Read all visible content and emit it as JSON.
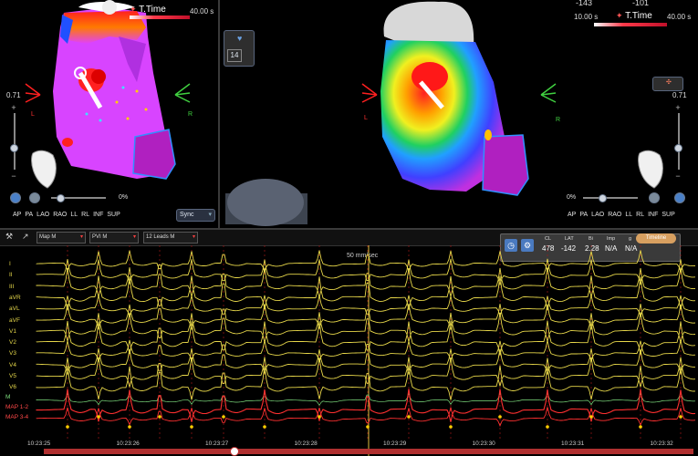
{
  "left_view": {
    "time_label": "T.Time",
    "seconds": "40.00 s",
    "scale_max": "0.71",
    "zoom_pct": "0%",
    "sync_label": "Sync",
    "views": [
      "AP",
      "PA",
      "LAO",
      "RAO",
      "LL",
      "RL",
      "INF",
      "SUP"
    ],
    "axis_l": "L",
    "axis_r": "R"
  },
  "right_view": {
    "top_vals": [
      "-143",
      "-101"
    ],
    "time_label": "T.Time",
    "start_seconds": "10.00 s",
    "seconds": "40.00 s",
    "scale_max": "0.71",
    "zoom_pct": "0%",
    "views": [
      "AP",
      "PA",
      "LAO",
      "RAO",
      "LL",
      "RL",
      "INF",
      "SUP"
    ],
    "axis_l": "L",
    "axis_r": "R",
    "counter": "14"
  },
  "toolbar": {
    "combo1": "Map M",
    "combo2": "PVI M",
    "combo3": "12 Leads M",
    "timeline_btn": "Timeline"
  },
  "ecg": {
    "speed": "50 mm/sec",
    "leads": [
      "I",
      "II",
      "III",
      "aVR",
      "aVL",
      "aVF",
      "V1",
      "V2",
      "V3",
      "V4",
      "V5",
      "V6"
    ],
    "mapping_leads": [
      "M",
      "MAP 1-2",
      "MAP 3-4"
    ],
    "times": [
      "10:23:25",
      "10:23:26",
      "10:23:27",
      "10:23:28",
      "10:23:29",
      "10:23:30",
      "10:23:31",
      "10:23:32"
    ],
    "info": {
      "headers": [
        "CL",
        "LAT",
        "Bi",
        "Imp",
        "g"
      ],
      "values": [
        "478",
        "-142",
        "2.28",
        "N/A",
        "N/A"
      ]
    },
    "colors": {
      "surface": "#e8d84a",
      "map": "#ff3030",
      "marker": "#ffd000"
    }
  }
}
